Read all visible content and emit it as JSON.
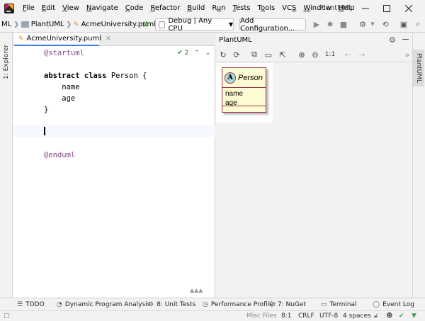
{
  "menu": {
    "items": [
      {
        "label": "File",
        "mnemonic": "F",
        "rest": "ile"
      },
      {
        "label": "Edit",
        "mnemonic": "E",
        "rest": "dit"
      },
      {
        "label": "View",
        "mnemonic": "V",
        "rest": "iew"
      },
      {
        "label": "Navigate",
        "mnemonic": "N",
        "rest": "avigate"
      },
      {
        "label": "Code",
        "mnemonic": "C",
        "rest": "ode"
      },
      {
        "label": "Refactor",
        "mnemonic": "R",
        "rest": "efactor"
      },
      {
        "label": "Build",
        "mnemonic": "B",
        "rest": "uild"
      },
      {
        "label": "Run",
        "mnemonic": "u",
        "pre": "R",
        "rest": "n"
      },
      {
        "label": "Tests",
        "mnemonic": "T",
        "rest": "ests"
      },
      {
        "label": "Tools",
        "mnemonic": "o",
        "pre": "T",
        "rest": "ols"
      },
      {
        "label": "VCS",
        "mnemonic": "S",
        "pre": "VC",
        "rest": ""
      },
      {
        "label": "Window",
        "mnemonic": "W",
        "rest": "indow"
      },
      {
        "label": "Help",
        "mnemonic": "H",
        "rest": "elp"
      }
    ],
    "window_title": "PlantUML"
  },
  "navbar": {
    "crumb_root": "ML",
    "crumb_project": "PlantUML",
    "crumb_file": "AcmeUniversity.puml",
    "run_config": "Debug | Any CPU",
    "add_config": "Add Configuration..."
  },
  "left_stripe": {
    "explorer_tab": "1: Explorer"
  },
  "right_stripe": {
    "plantuml_tab": "PlantUML"
  },
  "editor": {
    "tab_label": "AcmeUniversity.puml",
    "inspection_count": "2",
    "lines": [
      {
        "row": 0,
        "kind": "directive",
        "text": "@startuml"
      },
      {
        "row": 2,
        "kind": "class_decl",
        "kw": "abstract class",
        "text": " Person {"
      },
      {
        "row": 3,
        "kind": "plain",
        "text": "    name"
      },
      {
        "row": 4,
        "kind": "plain",
        "text": "    age"
      },
      {
        "row": 5,
        "kind": "plain",
        "text": "}"
      },
      {
        "row": 9,
        "kind": "directive",
        "text": "@enduml"
      }
    ]
  },
  "plantuml_pane": {
    "header": "PlantUML",
    "zoom_actual": "1:1",
    "diagram": {
      "badge": "A",
      "class_name": "Person",
      "attributes": [
        "name",
        "age"
      ]
    }
  },
  "bottom_tools": [
    {
      "id": "todo",
      "label": "TODO",
      "icon": "list-icon"
    },
    {
      "id": "dpa",
      "label": "Dynamic Program Analysis",
      "icon": "gauge-icon"
    },
    {
      "id": "unit-tests",
      "label": "8: Unit Tests",
      "icon": "unit-test-icon"
    },
    {
      "id": "profiler",
      "label": "Performance Profiler",
      "icon": "profiler-icon"
    },
    {
      "id": "nuget",
      "label": "7: NuGet",
      "icon": "nuget-icon"
    },
    {
      "id": "terminal",
      "label": "Terminal",
      "icon": "terminal-icon"
    },
    {
      "id": "event-log",
      "label": "Event Log",
      "icon": "event-log-icon"
    }
  ],
  "status": {
    "context": "Misc Files",
    "position": "8:1",
    "line_sep": "CRLF",
    "encoding": "UTF-8",
    "indent": "4 spaces"
  },
  "colors": {
    "class_border": "#a3314b",
    "class_fill": "#fdfbd2",
    "badge_fill": "#a9dcdf",
    "accent": "#4083c9",
    "run_green": "#499c54"
  }
}
